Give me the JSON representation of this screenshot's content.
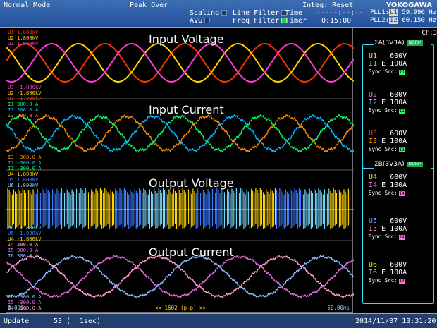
{
  "topbar": {
    "mode": "Normal Mode",
    "peak": "Peak Over",
    "scaling": "Scaling",
    "avg": "AVG",
    "line_filter": "Line Filter",
    "freq_filter": "Freq Filter",
    "integ": "Integ: Reset",
    "time_label": "Time",
    "time_value": "-----:--:--",
    "timer_label": "Timer",
    "timer_value": "0:15:00",
    "logo": "YOKOGAWA",
    "pll": [
      {
        "k": "PLL1:",
        "ch": "U1",
        "v": "59.996 Hz"
      },
      {
        "k": "PLL2:",
        "ch": "I2",
        "v": "60.150 Hz"
      }
    ]
  },
  "plot": {
    "titles": [
      "Input Voltage",
      "Input Current",
      "Output Voltage",
      "Output Current"
    ],
    "labels": [
      {
        "t": "U1 1.800kV",
        "c": "#ff3300"
      },
      {
        "t": "U2 1.800kV",
        "c": "#ffd600"
      },
      {
        "t": "U3 1.800kV",
        "c": "#ff3dd2"
      },
      {
        "t": "U3 -1.800kV",
        "c": "#ff3dd2"
      },
      {
        "t": "U2 -1.800kV",
        "c": "#ffd600"
      },
      {
        "t": "U1 -1.800kV",
        "c": "#ff3300"
      },
      {
        "t": "I1 300.0 A",
        "c": "#00ff66"
      },
      {
        "t": "I2 300.0 A",
        "c": "#00b8ff"
      },
      {
        "t": "I3 300.0 A",
        "c": "#ff8a00"
      },
      {
        "t": "I3 -300.0 A",
        "c": "#ff8a00"
      },
      {
        "t": "I2 -300.0 A",
        "c": "#00b8ff"
      },
      {
        "t": "I1 -300.0 A",
        "c": "#00ff66"
      },
      {
        "t": "U4 1.800kV",
        "c": "#ffd600"
      },
      {
        "t": "U5 1.800kV",
        "c": "#3d7dff"
      },
      {
        "t": "U6 1.800kV",
        "c": "#7ad8ff"
      },
      {
        "t": "U6 -1.800kV",
        "c": "#7ad8ff"
      },
      {
        "t": "U5 -1.800kV",
        "c": "#3d7dff"
      },
      {
        "t": "U4 -1.800kV",
        "c": "#ffd600"
      },
      {
        "t": "I4 300.0 A",
        "c": "#ff9ad5"
      },
      {
        "t": "I5 300.0 A",
        "c": "#e46ad9"
      },
      {
        "t": "I6 300.0 A",
        "c": "#8db8ff"
      },
      {
        "t": "I6 -300.0 A",
        "c": "#8db8ff"
      },
      {
        "t": "I5 -300.0 A",
        "c": "#e46ad9"
      },
      {
        "t": "I4 -300.0 A",
        "c": "#ff9ad5"
      }
    ],
    "time_start": "0.000s",
    "time_end": "50.00ms",
    "points_label": "<< 1602 (p-p) >>"
  },
  "side": {
    "cf": "CF:3",
    "group_a": "ΣA(3V3A)",
    "group_b": "ΣB(3V3A)",
    "group_mode": "NORM",
    "channels": [
      {
        "u": "U1",
        "urange": "600V",
        "i": "I1",
        "irange": "E 100A",
        "sync": "Sync Src:",
        "src": "I1",
        "uc": "#ffe600",
        "ic": "#22ff66"
      },
      {
        "u": "U2",
        "urange": "600V",
        "i": "I2",
        "irange": "E 100A",
        "sync": "Sync Src:",
        "src": "I1",
        "uc": "#ff69ff",
        "ic": "#7ed6ff"
      },
      {
        "u": "U3",
        "urange": "600V",
        "i": "I3",
        "irange": "E 100A",
        "sync": "Sync Src:",
        "src": "I1",
        "uc": "#ff3c3c",
        "ic": "#ffaa00"
      },
      {
        "u": "U4",
        "urange": "600V",
        "i": "I4",
        "irange": "E 100A",
        "sync": "Sync Src:",
        "src": "I4",
        "uc": "#ffe600",
        "ic": "#ff72d8"
      },
      {
        "u": "U5",
        "urange": "600V",
        "i": "I5",
        "irange": "E 100A",
        "sync": "Sync Src:",
        "src": "I4",
        "uc": "#5ca2ff",
        "ic": "#ff72d8"
      },
      {
        "u": "U6",
        "urange": "600V",
        "i": "I6",
        "irange": "E 100A",
        "sync": "Sync Src:",
        "src": "I4",
        "uc": "#ffe600",
        "ic": "#7ed6ff"
      }
    ]
  },
  "footer": {
    "update": "Update",
    "count": "53 (",
    "interval": "1sec)",
    "datetime": "2014/11/07 13:31:20"
  },
  "colors": {
    "bg": "#000000",
    "bar": "#2f63ad",
    "frame": "#38d8f7"
  }
}
